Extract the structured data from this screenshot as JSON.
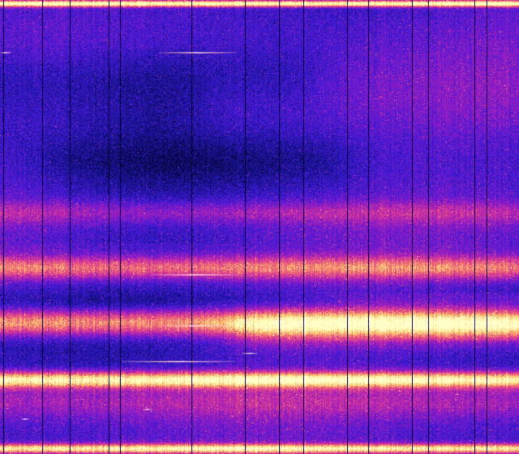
{
  "image": {
    "kind": "spectrogram-heatmap",
    "colormap": {
      "name": "plasma-like",
      "stops": [
        "#000014",
        "#10107a",
        "#3a1ad8",
        "#8a1ac8",
        "#d2309e",
        "#f06a70",
        "#ffd070",
        "#ffffc8"
      ]
    },
    "background_color": "#20126a",
    "features": {
      "vertical_dark_lines": "present",
      "horizontal_bright_bands": "present",
      "top_edge_band": "bright",
      "bottom_edge_band": "bright"
    }
  }
}
